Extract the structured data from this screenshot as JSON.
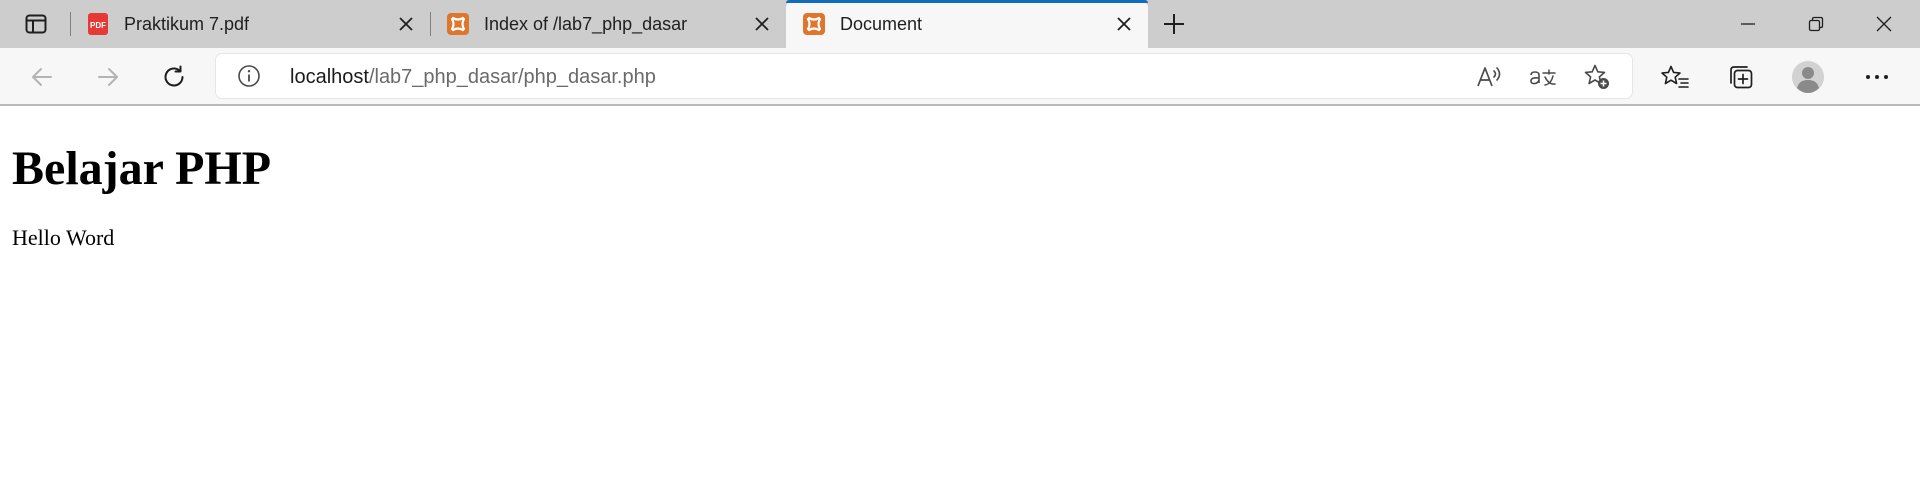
{
  "tabs": [
    {
      "title": "Praktikum 7.pdf",
      "favicon": "pdf-icon",
      "active": false
    },
    {
      "title": "Index of /lab7_php_dasar",
      "favicon": "xampp-icon",
      "active": false
    },
    {
      "title": "Document",
      "favicon": "xampp-icon",
      "active": true
    }
  ],
  "pdf_favicon_text": "PDF",
  "address_bar": {
    "host": "localhost",
    "path": "/lab7_php_dasar/php_dasar.php"
  },
  "icons": {
    "tab_actions": "tab-actions-icon",
    "new_tab": "plus-icon",
    "minimize": "minimize-icon",
    "restore": "restore-icon",
    "close_window": "close-icon",
    "back": "back-arrow-icon",
    "forward": "forward-arrow-icon",
    "refresh": "refresh-icon",
    "site_info": "info-icon",
    "read_aloud": "read-aloud-icon",
    "translate": "translate-icon",
    "add_favorite": "star-add-icon",
    "favorites": "favorites-icon",
    "collections": "collections-icon",
    "profile": "profile-avatar-icon",
    "menu": "more-icon"
  },
  "colors": {
    "tabstrip_bg": "#cdcdcd",
    "active_tab_accent": "#0f6cbd",
    "xampp_orange": "#e0762d",
    "pdf_red": "#e53935"
  },
  "page": {
    "heading": "Belajar PHP",
    "paragraph": "Hello Word"
  }
}
